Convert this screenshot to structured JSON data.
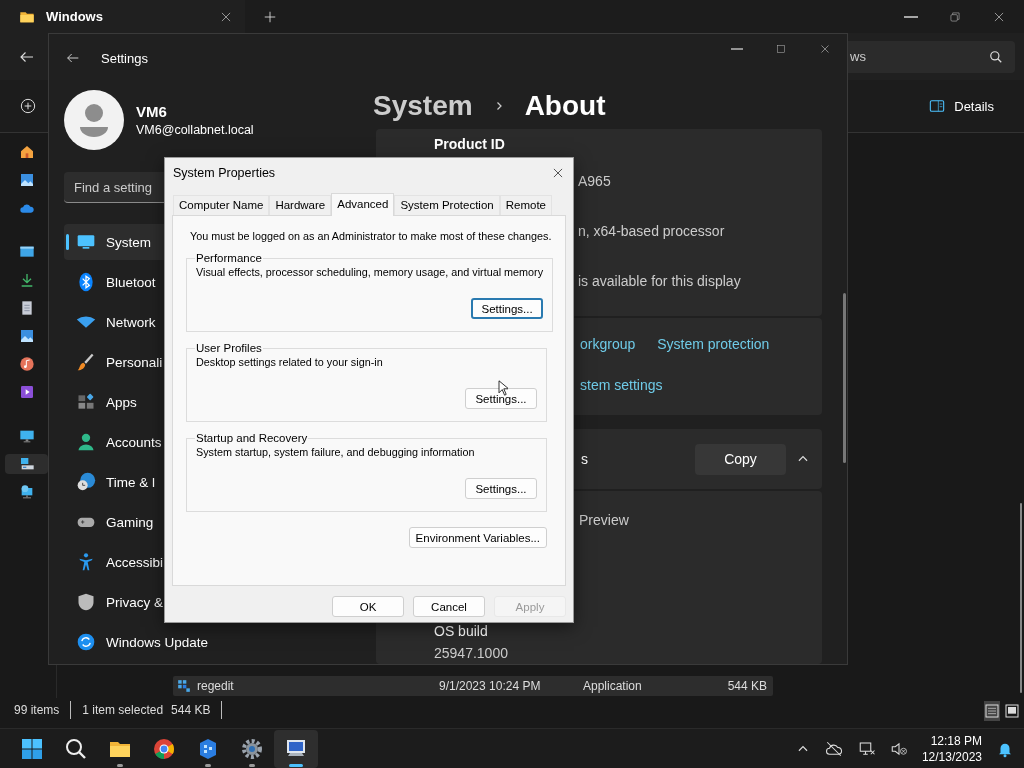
{
  "explorer": {
    "tab_title": "Windows",
    "search": {
      "value": "ws"
    },
    "details_label": "Details",
    "nav": [
      {
        "kind": "home",
        "selected": false
      },
      {
        "kind": "gallery",
        "selected": false
      },
      {
        "kind": "cloud",
        "selected": false
      },
      {
        "kind": "desktop",
        "selected": false
      },
      {
        "kind": "download",
        "selected": false
      },
      {
        "kind": "documents",
        "selected": false
      },
      {
        "kind": "pictures",
        "selected": false
      },
      {
        "kind": "music",
        "selected": false
      },
      {
        "kind": "videos",
        "selected": false
      },
      {
        "kind": "pc",
        "selected": false
      },
      {
        "kind": "drive",
        "selected": true
      },
      {
        "kind": "network",
        "selected": false
      }
    ],
    "files": [
      {
        "name": "regedit",
        "date": "9/1/2023 10:24 PM",
        "type": "Application",
        "size": "544 KB",
        "selected": true
      }
    ],
    "status": {
      "item_count": "99 items",
      "selection": "1 item selected",
      "selection_size": "544 KB"
    },
    "view_modes": [
      {
        "kind": "details",
        "selected": true
      },
      {
        "kind": "tiles",
        "selected": false
      }
    ]
  },
  "settings": {
    "title": "Settings",
    "user": {
      "name": "VM6",
      "email": "VM6@collabnet.local"
    },
    "search": {
      "placeholder": "Find a setting"
    },
    "nav": [
      {
        "kind": "system",
        "label": "System",
        "selected": true
      },
      {
        "kind": "bluetooth",
        "label": "Bluetoot",
        "selected": false
      },
      {
        "kind": "network",
        "label": "Network",
        "selected": false
      },
      {
        "kind": "personalization",
        "label": "Personali",
        "selected": false
      },
      {
        "kind": "apps",
        "label": "Apps",
        "selected": false
      },
      {
        "kind": "accounts",
        "label": "Accounts",
        "selected": false
      },
      {
        "kind": "time",
        "label": "Time & l",
        "selected": false
      },
      {
        "kind": "gaming",
        "label": "Gaming",
        "selected": false
      },
      {
        "kind": "accessibility",
        "label": "Accessibi",
        "selected": false
      },
      {
        "kind": "privacy",
        "label": "Privacy &",
        "selected": false
      },
      {
        "kind": "update",
        "label": "Windows Update",
        "selected": false
      }
    ],
    "breadcrumb": {
      "parent": "System",
      "current": "About"
    },
    "device_specs": [
      {
        "kind": "label",
        "text": "Product ID"
      },
      {
        "kind": "value",
        "text": "A965"
      },
      {
        "kind": "value",
        "text": "n, x64-based processor"
      },
      {
        "kind": "value",
        "text": "is available for this display"
      }
    ],
    "related_links": [
      [
        "orkgroup",
        "System protection"
      ],
      [
        "stem settings"
      ]
    ],
    "windows_specs": {
      "title": "s",
      "copy_button": "Copy",
      "expanded": true
    },
    "windows_details": [
      {
        "kind": "value",
        "text": "Preview"
      },
      {
        "kind": "label",
        "text": "OS build"
      },
      {
        "kind": "value",
        "text": "25947.1000"
      }
    ]
  },
  "dialog": {
    "title": "System Properties",
    "tabs": [
      {
        "label": "Computer Name",
        "selected": false
      },
      {
        "label": "Hardware",
        "selected": false
      },
      {
        "label": "Advanced",
        "selected": true
      },
      {
        "label": "System Protection",
        "selected": false
      },
      {
        "label": "Remote",
        "selected": false
      }
    ],
    "message": "You must be logged on as an Administrator to make most of these changes.",
    "groups": [
      {
        "title": "Performance",
        "description": "Visual effects, processor scheduling, memory usage, and virtual memory",
        "button": "Settings...",
        "focused": true
      },
      {
        "title": "User Profiles",
        "description": "Desktop settings related to your sign-in",
        "button": "Settings...",
        "focused": false
      },
      {
        "title": "Startup and Recovery",
        "description": "System startup, system failure, and debugging information",
        "button": "Settings...",
        "focused": false
      }
    ],
    "env_button": "Environment Variables...",
    "footer_buttons": [
      {
        "label": "OK",
        "disabled": false
      },
      {
        "label": "Cancel",
        "disabled": false
      },
      {
        "label": "Apply",
        "disabled": true
      }
    ]
  },
  "taskbar": {
    "apps": [
      {
        "kind": "start",
        "running": false,
        "active": false
      },
      {
        "kind": "search",
        "running": false,
        "active": false
      },
      {
        "kind": "folder",
        "running": true,
        "active": false
      },
      {
        "kind": "browser",
        "running": false,
        "active": false
      },
      {
        "kind": "cube",
        "running": true,
        "active": false
      },
      {
        "kind": "gear",
        "running": true,
        "active": false
      },
      {
        "kind": "remote",
        "running": true,
        "active": true
      }
    ],
    "time": "12:18 PM",
    "date": "12/13/2023"
  }
}
